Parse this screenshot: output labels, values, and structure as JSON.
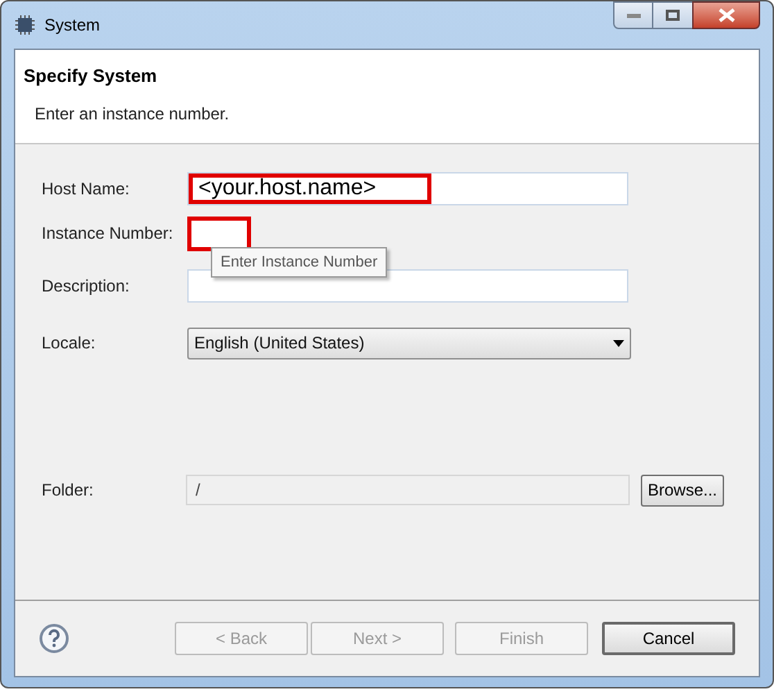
{
  "window": {
    "title": "System"
  },
  "header": {
    "title": "Specify System",
    "subtitle": "Enter an instance number."
  },
  "fields": [
    {
      "kind": "text",
      "label": "Host Name:",
      "value": "<your.host.name>",
      "highlighted": true
    },
    {
      "kind": "small",
      "label": "Instance Number:",
      "highlighted": true,
      "tooltip": "Enter Instance Number"
    },
    {
      "kind": "text",
      "label": "Description:",
      "highlighted": false
    },
    {
      "kind": "combo",
      "label": "Locale:",
      "value": "English (United States)",
      "highlighted": false
    }
  ],
  "folder": {
    "label": "Folder:",
    "value": "/",
    "button": "Browse..."
  },
  "buttons": [
    {
      "label": "< Back",
      "disabled": true,
      "default": false
    },
    {
      "label": "Next >",
      "disabled": true,
      "default": false
    },
    {
      "label": "Finish",
      "disabled": true,
      "default": false
    },
    {
      "label": "Cancel",
      "disabled": false,
      "default": true
    }
  ]
}
